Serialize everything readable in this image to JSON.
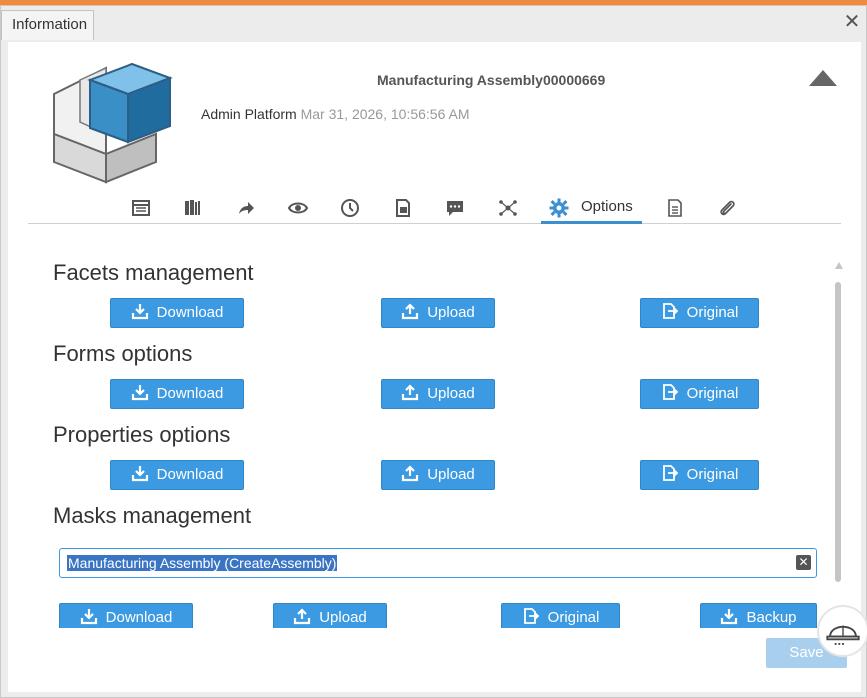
{
  "tab": {
    "label": "Information"
  },
  "header": {
    "title": "Manufacturing Assembly00000669",
    "user": "Admin",
    "platform": "Platform",
    "date": "Mar 31, 2026, 10:56:56 AM"
  },
  "toolbar": {
    "options_label": "Options"
  },
  "sections": [
    {
      "title": "Facets management"
    },
    {
      "title": "Forms options"
    },
    {
      "title": "Properties options"
    },
    {
      "title": "Masks management"
    }
  ],
  "buttons": {
    "download": "Download",
    "upload": "Upload",
    "original": "Original",
    "backup": "Backup"
  },
  "mask": {
    "value": "Manufacturing Assembly (CreateAssembly)"
  },
  "footer": {
    "save_label": "Save"
  },
  "colors": {
    "accent": "#3b9ae1",
    "active_tab": "#3a8fd0",
    "top_bar": "#f08a3c"
  }
}
